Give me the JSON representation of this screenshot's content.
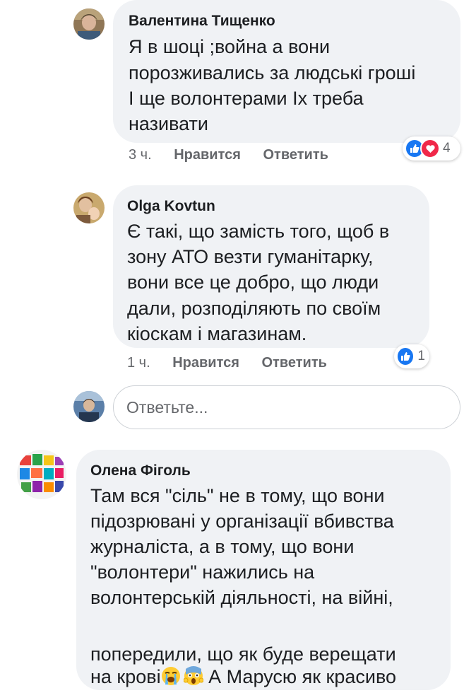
{
  "comments": [
    {
      "author": "Валентина Тищенко",
      "lines": [
        "Я в шоці ;война а вони",
        "порозживались за людські гроші",
        "І ще волонтерами Іх треба",
        "називати"
      ],
      "time": "3 ч.",
      "like_label": "Нравится",
      "reply_label": "Ответить",
      "reactions": [
        "like-icon",
        "love-icon"
      ],
      "reaction_count": "4"
    },
    {
      "author": "Olga Kovtun",
      "lines": [
        "Є такі, що замість того, щоб в",
        "зону АТО везти гуманітарку,",
        "вони все це добро, що люди",
        "дали, розподіляють по своїм",
        "кіоскам і магазинам."
      ],
      "time": "1 ч.",
      "like_label": "Нравится",
      "reply_label": "Ответить",
      "reactions": [
        "like-icon"
      ],
      "reaction_count": "1"
    },
    {
      "author": "Олена Фіголь",
      "lines": [
        "Там вся \"сіль\" не в тому, що вони",
        "підозрювані у організації вбивства",
        "журналіста, а в тому, що вони",
        "\"волонтери\" нажились на",
        "волонтерській діяльності, на війні,",
        "на крові",
        " А Марусю як красиво",
        "попередили, що як буде верещати"
      ],
      "emojis": [
        "loudly-crying-face-emoji",
        "screaming-face-emoji"
      ]
    }
  ],
  "reply_box": {
    "placeholder": "Ответьте..."
  },
  "colors": {
    "bubble": "#f0f2f5",
    "meta_text": "#65676b",
    "like_blue": "#1877f2",
    "love_red": "#f02849"
  }
}
